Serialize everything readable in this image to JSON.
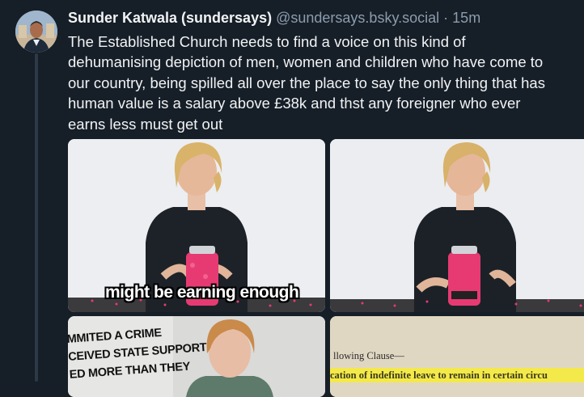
{
  "post": {
    "display_name": "Sunder Katwala (sundersays)",
    "handle": "@sundersays.bsky.social",
    "separator": "·",
    "time": "15m",
    "text": "The Established Church needs to find a voice on this kind of\ndehumanising depiction of men, women and children who have come to\nour country, being spilled all over the place to say the only thing that has\nhuman value is a salary above £38k and thst any foreigner who ever\nearns less must get out"
  },
  "images": {
    "video_caption": "might be earning enough",
    "overlay_lines": [
      "MMITED A CRIME",
      "CEIVED STATE SUPPORT",
      "ED MORE THAN THEY"
    ],
    "doc_line1": "llowing Clause—",
    "doc_line2": "cation of indefinite leave to remain in certain circu"
  },
  "colors": {
    "background": "#161e27",
    "text_primary": "#f1f3f5",
    "text_secondary": "#8c9cae",
    "highlight": "#f4e94a"
  }
}
